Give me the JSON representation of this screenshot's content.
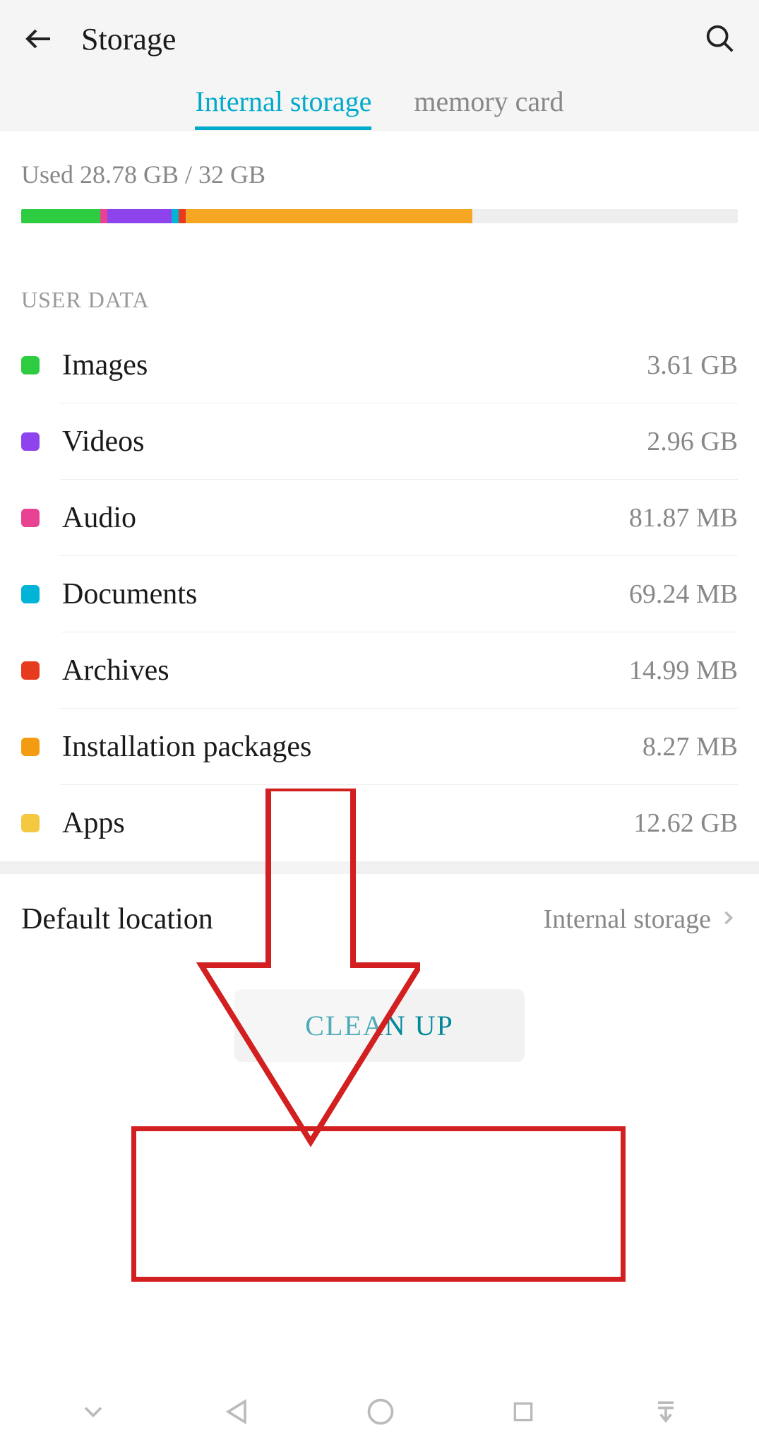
{
  "header": {
    "title": "Storage"
  },
  "tabs": {
    "items": [
      {
        "label": "Internal storage",
        "active": true
      },
      {
        "label": "memory card",
        "active": false
      }
    ]
  },
  "usage": {
    "text": "Used 28.78 GB / 32 GB",
    "segments": [
      {
        "color": "#2ecc40",
        "width": "11.0%"
      },
      {
        "color": "#e84393",
        "width": "1.0%"
      },
      {
        "color": "#8e44ec",
        "width": "9.0%"
      },
      {
        "color": "#00b4d8",
        "width": "1.0%"
      },
      {
        "color": "#e63b1f",
        "width": "1.0%"
      },
      {
        "color": "#f5a623",
        "width": "40.0%"
      }
    ]
  },
  "user_data": {
    "header": "USER DATA",
    "items": [
      {
        "color": "#2ecc40",
        "label": "Images",
        "value": "3.61 GB"
      },
      {
        "color": "#8e44ec",
        "label": "Videos",
        "value": "2.96 GB"
      },
      {
        "color": "#e84393",
        "label": "Audio",
        "value": "81.87 MB"
      },
      {
        "color": "#00b4d8",
        "label": "Documents",
        "value": "69.24 MB"
      },
      {
        "color": "#e63b1f",
        "label": "Archives",
        "value": "14.99 MB"
      },
      {
        "color": "#f39c12",
        "label": "Installation packages",
        "value": "8.27 MB"
      },
      {
        "color": "#f5c842",
        "label": "Apps",
        "value": "12.62 GB"
      }
    ]
  },
  "default_location": {
    "label": "Default location",
    "value": "Internal storage"
  },
  "buttons": {
    "cleanup": "CLEAN UP"
  }
}
